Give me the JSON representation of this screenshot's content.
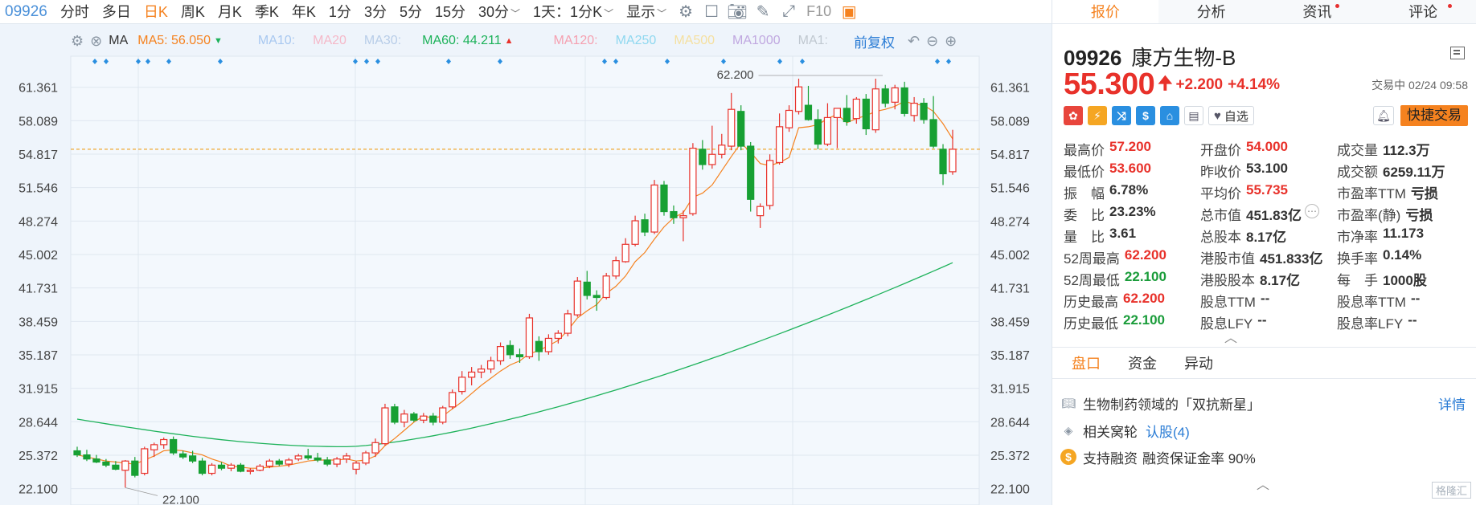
{
  "toolbar": {
    "code": "09926",
    "periods": [
      "分时",
      "多日",
      "日K",
      "周K",
      "月K",
      "季K",
      "年K",
      "1分",
      "3分",
      "5分",
      "15分",
      "30分"
    ],
    "active_period": "日K",
    "adjust": "1天：1分K",
    "display": "显示",
    "f10": "F10"
  },
  "ma_bar": {
    "ma_label": "MA",
    "ma5": "MA5: 56.050",
    "ma10": "MA10:",
    "ma20": "MA20",
    "ma30": "MA30:",
    "ma60": "MA60: 44.211",
    "ma120": "MA120:",
    "ma250": "MA250",
    "ma500": "MA500",
    "ma1000": "MA1000",
    "ma1": "MA1:",
    "fq": "前复权",
    "colors": {
      "ma5": "#f5821f",
      "ma10": "#a8c8f0",
      "ma20": "#f5b8c8",
      "ma30": "#b8cde8",
      "ma60": "#1db25a",
      "ma120": "#f5a0b0",
      "ma250": "#8fd8f0",
      "ma500": "#f5e0a0",
      "ma1000": "#c0a8e0",
      "ma1": "#c0c8d0"
    }
  },
  "chart_data": {
    "type": "candlestick",
    "current_price": "55.300",
    "high_label": "62.200",
    "low_label": "22.100",
    "y_ticks": [
      "61.361",
      "58.089",
      "54.817",
      "51.546",
      "48.274",
      "45.002",
      "41.731",
      "38.459",
      "35.187",
      "31.915",
      "28.644",
      "25.372",
      "22.100"
    ],
    "ylim": [
      20.5,
      64.4
    ],
    "up_color": "#e8312a",
    "down_color": "#17a033",
    "candles": [
      [
        25.8,
        26.2,
        25.2,
        25.4
      ],
      [
        25.4,
        25.9,
        24.8,
        25.0
      ],
      [
        25.0,
        25.4,
        24.6,
        24.7
      ],
      [
        24.7,
        25.0,
        24.2,
        24.4
      ],
      [
        24.4,
        24.8,
        23.9,
        24.0
      ],
      [
        23.9,
        24.9,
        22.2,
        24.8
      ],
      [
        24.8,
        25.2,
        23.2,
        23.4
      ],
      [
        23.6,
        26.2,
        23.4,
        26.0
      ],
      [
        25.9,
        26.6,
        25.2,
        26.4
      ],
      [
        26.4,
        27.1,
        26.0,
        26.9
      ],
      [
        26.9,
        27.2,
        25.4,
        25.6
      ],
      [
        25.5,
        25.8,
        25.0,
        25.2
      ],
      [
        25.3,
        25.8,
        24.6,
        24.8
      ],
      [
        24.8,
        25.1,
        23.4,
        23.6
      ],
      [
        23.6,
        24.6,
        23.4,
        24.4
      ],
      [
        24.4,
        24.7,
        23.9,
        24.1
      ],
      [
        24.1,
        24.6,
        23.8,
        24.4
      ],
      [
        24.4,
        24.6,
        23.7,
        23.8
      ],
      [
        23.8,
        24.1,
        23.5,
        23.9
      ],
      [
        23.9,
        24.5,
        23.8,
        24.3
      ],
      [
        24.3,
        25.0,
        24.1,
        24.8
      ],
      [
        24.8,
        25.0,
        24.3,
        24.5
      ],
      [
        24.5,
        25.1,
        24.2,
        24.9
      ],
      [
        25.0,
        25.5,
        24.8,
        25.3
      ],
      [
        25.3,
        26.0,
        24.9,
        25.1
      ],
      [
        25.1,
        25.6,
        24.7,
        24.9
      ],
      [
        24.9,
        25.2,
        24.3,
        24.5
      ],
      [
        24.5,
        25.2,
        24.2,
        25.0
      ],
      [
        25.0,
        25.6,
        24.6,
        25.3
      ],
      [
        24.0,
        24.8,
        23.5,
        24.6
      ],
      [
        24.6,
        25.8,
        24.4,
        25.6
      ],
      [
        25.6,
        27.0,
        25.2,
        26.6
      ],
      [
        26.5,
        30.4,
        26.3,
        30.0
      ],
      [
        30.1,
        30.4,
        28.4,
        28.6
      ],
      [
        28.6,
        29.8,
        28.1,
        29.4
      ],
      [
        29.4,
        29.6,
        28.6,
        28.8
      ],
      [
        28.8,
        29.5,
        28.5,
        29.2
      ],
      [
        29.2,
        29.5,
        28.3,
        28.6
      ],
      [
        28.6,
        30.2,
        28.4,
        30.0
      ],
      [
        30.1,
        31.8,
        29.9,
        31.5
      ],
      [
        31.6,
        33.6,
        31.3,
        33.0
      ],
      [
        33.0,
        34.0,
        32.2,
        33.5
      ],
      [
        33.5,
        34.2,
        32.9,
        33.8
      ],
      [
        33.8,
        35.0,
        33.4,
        34.6
      ],
      [
        34.6,
        36.4,
        34.2,
        36.0
      ],
      [
        36.1,
        36.6,
        34.8,
        35.2
      ],
      [
        35.2,
        35.8,
        34.4,
        35.0
      ],
      [
        35.0,
        39.2,
        34.8,
        38.8
      ],
      [
        36.5,
        37.0,
        34.6,
        35.5
      ],
      [
        35.5,
        37.2,
        35.2,
        36.8
      ],
      [
        36.8,
        37.6,
        36.3,
        37.3
      ],
      [
        37.3,
        39.6,
        37.0,
        39.2
      ],
      [
        39.1,
        42.8,
        38.9,
        42.4
      ],
      [
        42.3,
        43.4,
        40.6,
        41.0
      ],
      [
        41.0,
        41.5,
        39.5,
        40.8
      ],
      [
        40.8,
        43.2,
        40.6,
        42.9
      ],
      [
        42.9,
        44.8,
        42.6,
        44.4
      ],
      [
        44.3,
        46.6,
        44.2,
        46.0
      ],
      [
        46.0,
        48.8,
        45.8,
        48.3
      ],
      [
        48.4,
        49.0,
        46.8,
        47.2
      ],
      [
        47.2,
        52.3,
        47.0,
        51.8
      ],
      [
        51.8,
        52.2,
        48.8,
        49.2
      ],
      [
        49.2,
        49.8,
        48.0,
        48.6
      ],
      [
        48.6,
        49.3,
        46.3,
        48.8
      ],
      [
        49.0,
        55.9,
        48.8,
        55.4
      ],
      [
        55.3,
        56.2,
        53.3,
        53.8
      ],
      [
        53.8,
        57.6,
        53.4,
        54.8
      ],
      [
        54.8,
        56.8,
        54.4,
        55.7
      ],
      [
        55.6,
        60.8,
        55.2,
        59.2
      ],
      [
        59.0,
        59.6,
        55.2,
        55.6
      ],
      [
        55.6,
        56.0,
        49.2,
        50.4
      ],
      [
        48.8,
        50.0,
        47.6,
        49.7
      ],
      [
        49.8,
        54.8,
        49.4,
        54.2
      ],
      [
        54.0,
        58.8,
        53.8,
        57.5
      ],
      [
        57.4,
        59.6,
        57.0,
        59.1
      ],
      [
        59.0,
        62.2,
        58.7,
        61.4
      ],
      [
        59.6,
        61.5,
        58.1,
        58.2
      ],
      [
        58.2,
        59.2,
        55.3,
        55.8
      ],
      [
        55.8,
        59.8,
        55.6,
        58.4
      ],
      [
        58.4,
        59.0,
        55.4,
        59.3
      ],
      [
        59.3,
        60.6,
        57.6,
        58.0
      ],
      [
        58.3,
        60.4,
        57.8,
        60.2
      ],
      [
        60.2,
        60.7,
        56.7,
        57.3
      ],
      [
        57.2,
        62.2,
        56.9,
        61.2
      ],
      [
        61.2,
        61.6,
        59.4,
        59.8
      ],
      [
        59.9,
        61.6,
        59.2,
        61.3
      ],
      [
        61.3,
        61.9,
        58.5,
        58.8
      ],
      [
        58.6,
        60.4,
        58.0,
        59.8
      ],
      [
        59.8,
        60.3,
        57.8,
        58.2
      ],
      [
        58.2,
        60.5,
        55.4,
        55.6
      ],
      [
        55.3,
        55.8,
        51.8,
        52.9
      ],
      [
        53.1,
        57.2,
        52.8,
        55.3
      ]
    ],
    "ma5": [
      25.4,
      25.2,
      25.0,
      24.8,
      24.7,
      24.6,
      24.5,
      24.9,
      25.3,
      25.8,
      25.9,
      25.8,
      25.6,
      25.4,
      25.0,
      24.7,
      24.3,
      24.2,
      24.1,
      24.1,
      24.2,
      24.3,
      24.4,
      24.6,
      24.8,
      24.9,
      24.9,
      24.9,
      25.0,
      24.8,
      24.9,
      25.3,
      26.3,
      27.0,
      27.8,
      28.6,
      29.2,
      29.0,
      29.2,
      29.9,
      30.6,
      31.4,
      32.2,
      32.9,
      33.6,
      34.2,
      34.6,
      35.3,
      35.6,
      36.1,
      36.6,
      37.6,
      38.8,
      39.5,
      40.1,
      41.2,
      41.9,
      42.9,
      44.3,
      45.2,
      46.5,
      47.7,
      48.6,
      49.1,
      50.6,
      51.0,
      51.8,
      53.2,
      54.6,
      55.9,
      55.0,
      53.9,
      53.7,
      54.0,
      54.5,
      57.4,
      57.5,
      57.7,
      58.3,
      58.7,
      57.9,
      58.3,
      58.6,
      59.0,
      59.2,
      59.5,
      60.0,
      59.7,
      59.6,
      59.0,
      57.8,
      56.3
    ],
    "ma60_start": 28.9,
    "ma60_valley_index": 28,
    "ma60_valley": 26.2,
    "ma60_end": 44.2
  },
  "quote": {
    "tabs": [
      "报价",
      "分析",
      "资讯",
      "评论"
    ],
    "active_tab": "报价",
    "code": "09926",
    "name": "康方生物-B",
    "price": "55.300",
    "change": "+2.200",
    "change_pct": "+4.14%",
    "status": "交易中 02/24 09:58",
    "watch": "自选",
    "fast_trade": "快捷交易",
    "stats": [
      [
        {
          "l": "最高价",
          "v": "57.200",
          "c": "red"
        },
        {
          "l": "开盘价",
          "v": "54.000",
          "c": "red"
        },
        {
          "l": "成交量",
          "v": "112.3万",
          "c": ""
        }
      ],
      [
        {
          "l": "最低价",
          "v": "53.600",
          "c": "red"
        },
        {
          "l": "昨收价",
          "v": "53.100",
          "c": ""
        },
        {
          "l": "成交额",
          "v": "6259.11万",
          "c": ""
        }
      ],
      [
        {
          "l": "振　幅",
          "v": "6.78%",
          "c": ""
        },
        {
          "l": "平均价",
          "v": "55.735",
          "c": "red"
        },
        {
          "l": "市盈率TTM",
          "v": "亏损",
          "c": ""
        }
      ],
      [
        {
          "l": "委　比",
          "v": "23.23%",
          "c": ""
        },
        {
          "l": "总市值",
          "v": "451.83亿",
          "c": ""
        },
        {
          "l": "市盈率(静)",
          "v": "亏损",
          "c": ""
        }
      ],
      [
        {
          "l": "量　比",
          "v": "3.61",
          "c": ""
        },
        {
          "l": "总股本",
          "v": "8.17亿",
          "c": ""
        },
        {
          "l": "市净率",
          "v": "11.173",
          "c": ""
        }
      ],
      [
        {
          "l": "52周最高",
          "v": "62.200",
          "c": "red"
        },
        {
          "l": "港股市值",
          "v": "451.833亿",
          "c": ""
        },
        {
          "l": "换手率",
          "v": "0.14%",
          "c": ""
        }
      ],
      [
        {
          "l": "52周最低",
          "v": "22.100",
          "c": "green"
        },
        {
          "l": "港股股本",
          "v": "8.17亿",
          "c": ""
        },
        {
          "l": "每　手",
          "v": "1000股",
          "c": ""
        }
      ],
      [
        {
          "l": "历史最高",
          "v": "62.200",
          "c": "red"
        },
        {
          "l": "股息TTM",
          "v": "--",
          "c": ""
        },
        {
          "l": "股息率TTM",
          "v": "--",
          "c": ""
        }
      ],
      [
        {
          "l": "历史最低",
          "v": "22.100",
          "c": "green"
        },
        {
          "l": "股息LFY",
          "v": "--",
          "c": ""
        },
        {
          "l": "股息率LFY",
          "v": "--",
          "c": ""
        }
      ]
    ],
    "sub_tabs": [
      "盘口",
      "资金",
      "异动"
    ],
    "active_sub_tab": "盘口",
    "info": {
      "concept": "生物制药领域的「双抗新星」",
      "detail": "详情",
      "related": "相关窝轮",
      "warrants": "认股(4)",
      "margin": "支持融资",
      "margin_rate": "融资保证金率 90%"
    },
    "watermark": "格隆汇"
  }
}
